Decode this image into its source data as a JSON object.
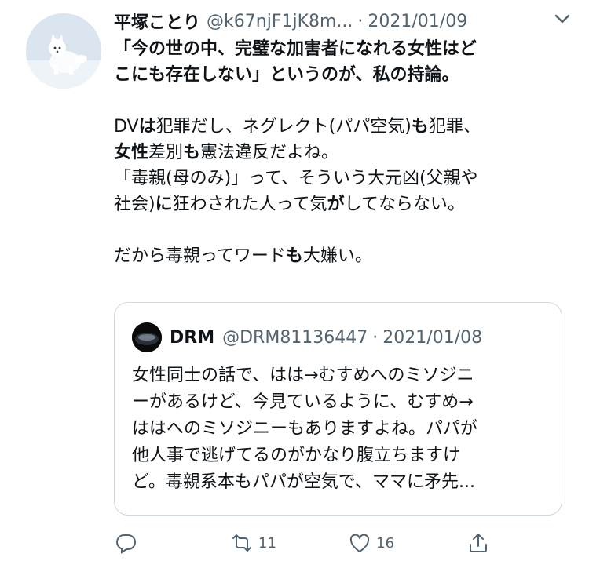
{
  "tweet": {
    "author_name": "平塚ことり",
    "handle": "@k67njF1jK8m...",
    "separator": "·",
    "date": "2021/01/09",
    "lines": [
      [
        {
          "t": "「今の世の中、完璧な加害者になれる女性はど",
          "b": true
        }
      ],
      [
        {
          "t": "こにも存在しない」というのが、私の持論。",
          "b": true
        }
      ],
      [],
      [
        {
          "t": "DV",
          "b": false
        },
        {
          "t": "は",
          "b": true
        },
        {
          "t": "犯罪だし、ネグレクト(パパ空気)",
          "b": false
        },
        {
          "t": "も",
          "b": true
        },
        {
          "t": "犯罪、",
          "b": false
        }
      ],
      [
        {
          "t": "女性",
          "b": true
        },
        {
          "t": "差別",
          "b": false
        },
        {
          "t": "も",
          "b": true
        },
        {
          "t": "憲法違反だよね。",
          "b": false
        }
      ],
      [
        {
          "t": "「毒親(母のみ)」って、そういう大元凶(父親や",
          "b": false
        }
      ],
      [
        {
          "t": "社会)",
          "b": false
        },
        {
          "t": "に",
          "b": true
        },
        {
          "t": "狂わされた人って気",
          "b": false
        },
        {
          "t": "が",
          "b": true
        },
        {
          "t": "してならない。",
          "b": false
        }
      ],
      [],
      [
        {
          "t": "だから毒親ってワード",
          "b": false
        },
        {
          "t": "も",
          "b": true
        },
        {
          "t": "大嫌い。",
          "b": false
        }
      ]
    ]
  },
  "quote": {
    "author_name": "DRM",
    "handle": "@DRM81136447",
    "separator": "·",
    "date": "2021/01/08",
    "lines": [
      "女性同士の話で、はは→むすめへのミソジニ",
      "ーがあるけど、今見ているように、むすめ→",
      "ははへのミソジニーもありますよね。パパが",
      "他人事で逃げてるのがかなり腹立ちますけ",
      "ど。毒親系本もパパが空気で、ママに矛先..."
    ]
  },
  "actions": {
    "reply_count": "",
    "retweet_count": "11",
    "like_count": "16"
  },
  "icons": {
    "avatar": "arctic-fox-avatar",
    "quote_avatar": "dark-object-avatar",
    "more": "chevron-down-icon",
    "reply": "reply-icon",
    "retweet": "retweet-icon",
    "like": "heart-icon",
    "share": "share-icon"
  },
  "colors": {
    "text": "#0f1419",
    "secondary": "#536471",
    "border": "#cfd9de"
  }
}
